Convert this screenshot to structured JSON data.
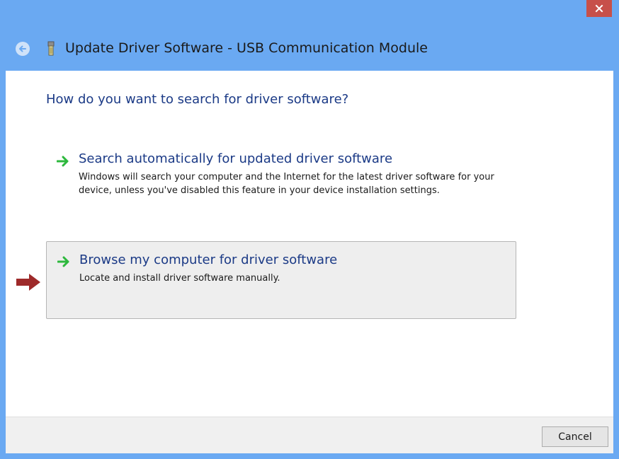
{
  "window": {
    "title": "Update Driver Software - USB Communication Module",
    "close_icon": "close-icon",
    "back_icon": "back-arrow-icon",
    "device_icon": "usb-device-icon",
    "colors": {
      "chrome": "#6aa9f2",
      "close": "#c7504a",
      "heading_text": "#1b3a86",
      "option_arrow": "#2db83d",
      "pointer_arrow": "#9e2a2a"
    }
  },
  "main": {
    "question": "How do you want to search for driver software?",
    "options": [
      {
        "title": "Search automatically for updated driver software",
        "description": "Windows will search your computer and the Internet for the latest driver software for your device, unless you've disabled this feature in your device installation settings.",
        "icon": "green-arrow-icon",
        "highlighted": false
      },
      {
        "title": "Browse my computer for driver software",
        "description": "Locate and install driver software manually.",
        "icon": "green-arrow-icon",
        "highlighted": true
      }
    ],
    "pointer_icon": "red-pointer-arrow-icon"
  },
  "footer": {
    "cancel_label": "Cancel"
  }
}
